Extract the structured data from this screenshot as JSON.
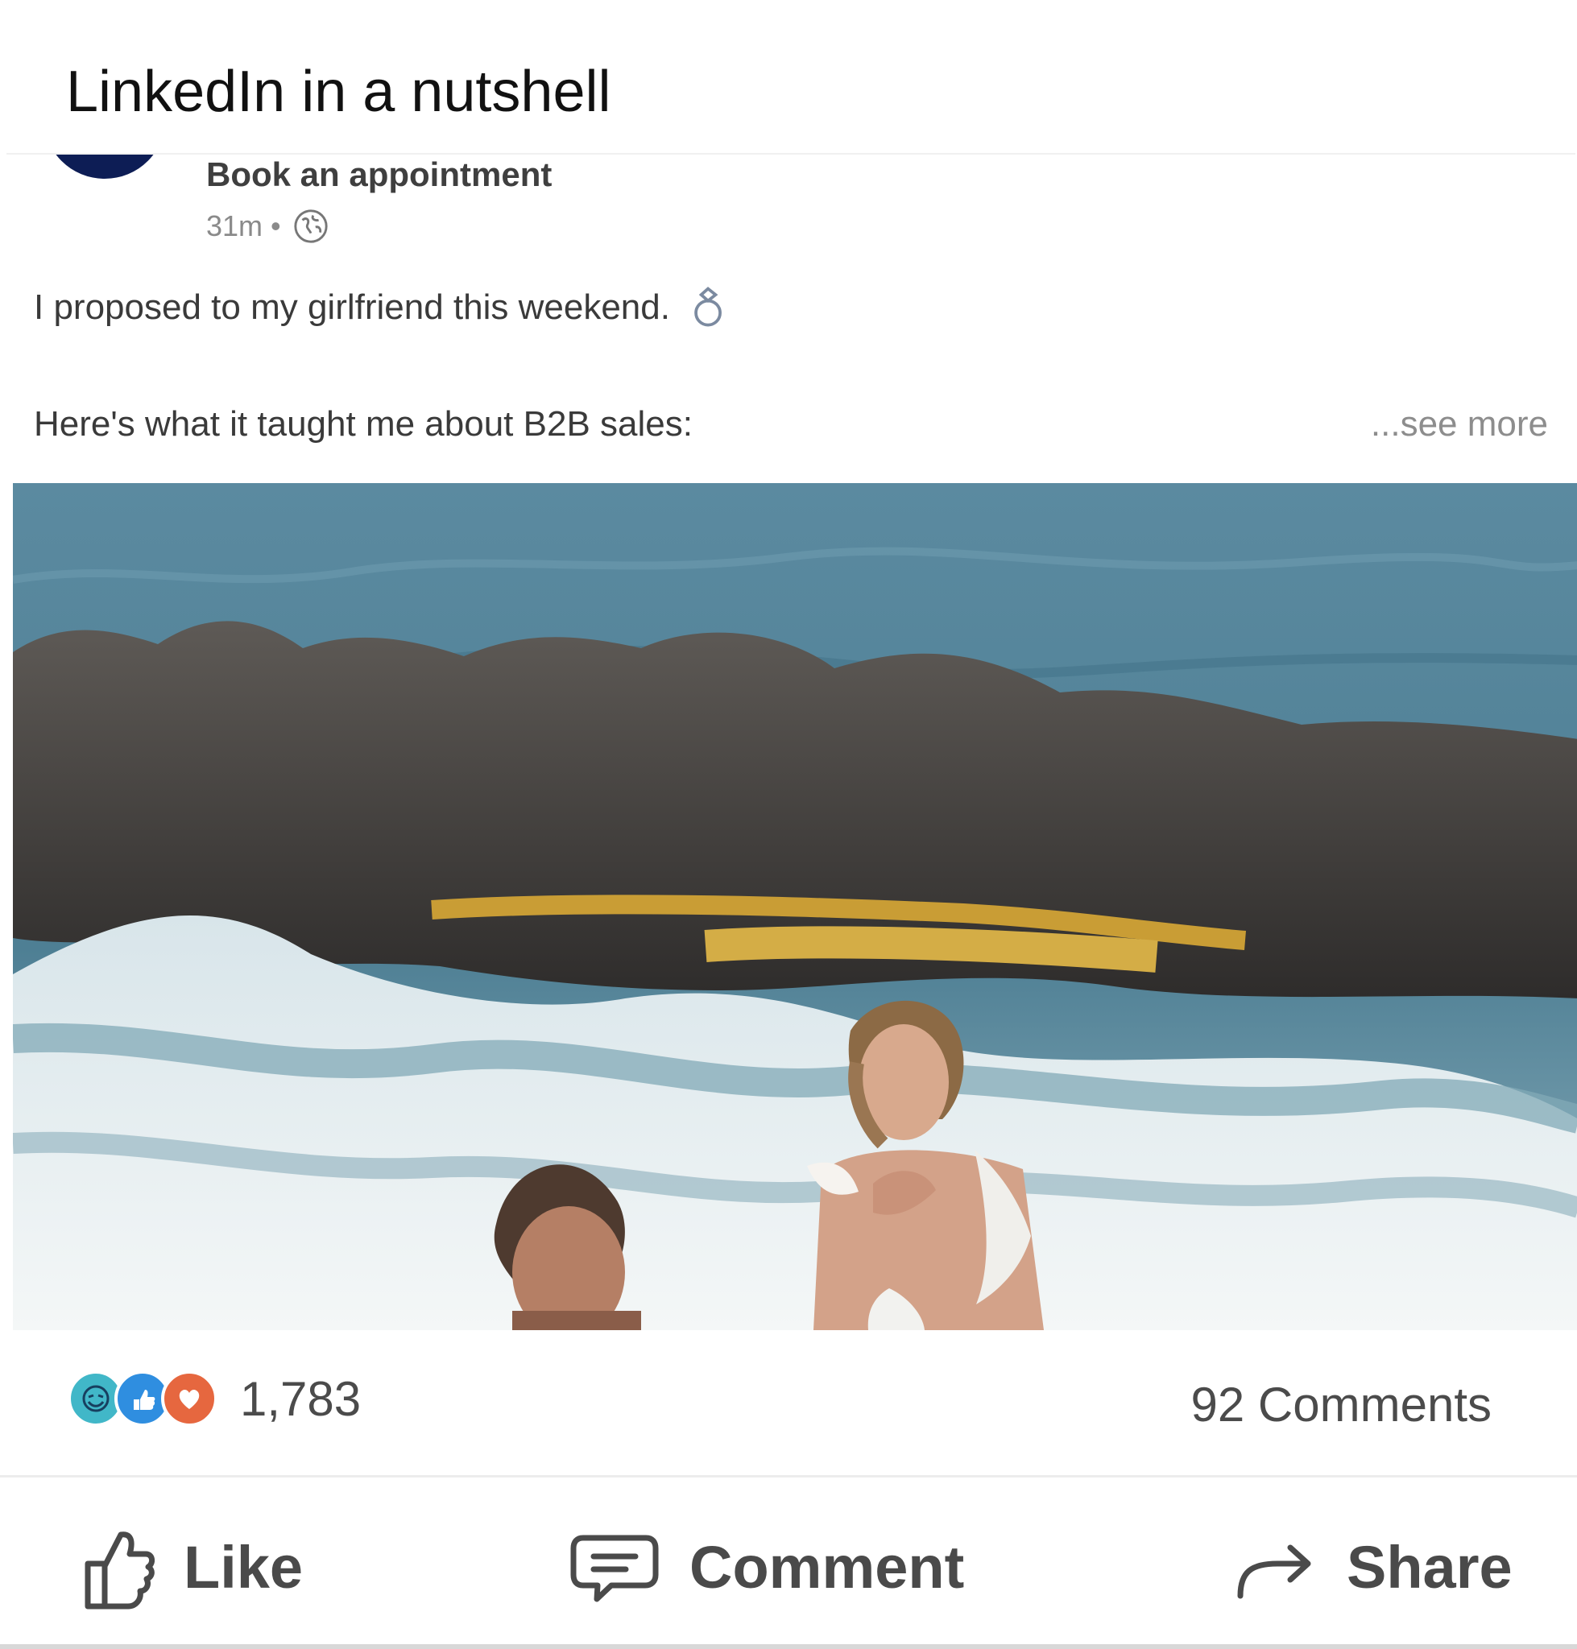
{
  "caption": "LinkedIn in a nutshell",
  "post": {
    "author_subtitle": "Book an appointment",
    "time": "31m",
    "separator": "•",
    "visibility_icon": "globe-icon",
    "line1": "I proposed to my girlfriend this weekend.",
    "line1_icon": "ring-icon",
    "line2": "Here's what it taught me about B2B sales:",
    "see_more": "...see more",
    "image_alt_icon": "beach-proposal-photo"
  },
  "social": {
    "reaction_icons": [
      "laugh-reaction-icon",
      "like-reaction-icon",
      "love-reaction-icon"
    ],
    "reaction_count": "1,783",
    "comments": "92 Comments"
  },
  "actions": {
    "like": "Like",
    "comment": "Comment",
    "share": "Share"
  },
  "colors": {
    "avatar": "#0d1d55",
    "laugh": "#41b7c8",
    "like": "#2f8ee0",
    "love": "#e6673f",
    "muted_text": "#8a8a8a",
    "action_text": "#4a4a4a"
  }
}
